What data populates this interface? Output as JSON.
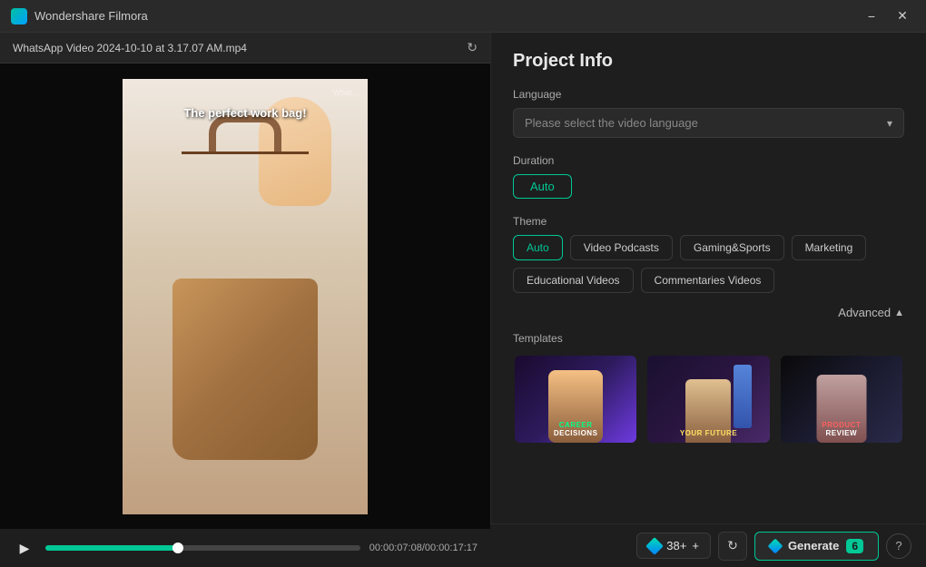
{
  "titlebar": {
    "app_name": "Wondershare Filmora",
    "minimize_label": "−",
    "close_label": "✕"
  },
  "file_bar": {
    "file_name": "WhatsApp Video 2024-10-10 at 3.17.07 AM.mp4",
    "refresh_icon": "↻"
  },
  "video": {
    "caption": "The perfect work bag!",
    "watermark": "What..."
  },
  "controls": {
    "play_icon": "▶",
    "current_time": "00:00:07:08",
    "total_time": "/00:00:17:17",
    "progress_percent": 42
  },
  "right_panel": {
    "title": "Project Info",
    "language_section": {
      "label": "Language",
      "dropdown_placeholder": "Please select the video language"
    },
    "duration_section": {
      "label": "Duration",
      "auto_button": "Auto"
    },
    "theme_section": {
      "label": "Theme",
      "buttons": [
        {
          "id": "auto",
          "label": "Auto",
          "active": true
        },
        {
          "id": "video-podcasts",
          "label": "Video Podcasts",
          "active": false
        },
        {
          "id": "gaming-sports",
          "label": "Gaming&Sports",
          "active": false
        },
        {
          "id": "marketing",
          "label": "Marketing",
          "active": false
        },
        {
          "id": "educational",
          "label": "Educational Videos",
          "active": false
        },
        {
          "id": "commentaries",
          "label": "Commentaries Videos",
          "active": false
        }
      ]
    },
    "advanced": {
      "label": "Advanced",
      "icon": "▲"
    },
    "templates": {
      "label": "Templates",
      "items": [
        {
          "id": "career",
          "top_label": "CAREER",
          "bottom_label": "DECISIONS"
        },
        {
          "id": "future",
          "label": "YOUR FUTURE"
        },
        {
          "id": "product",
          "top_label": "PRODUCT",
          "bottom_label": "REVIEW"
        }
      ]
    }
  },
  "bottom_bar": {
    "points_count": "38+",
    "plus_label": "+",
    "refresh_icon": "↻",
    "generate_label": "Generate",
    "generate_count": "6",
    "help_icon": "?"
  }
}
